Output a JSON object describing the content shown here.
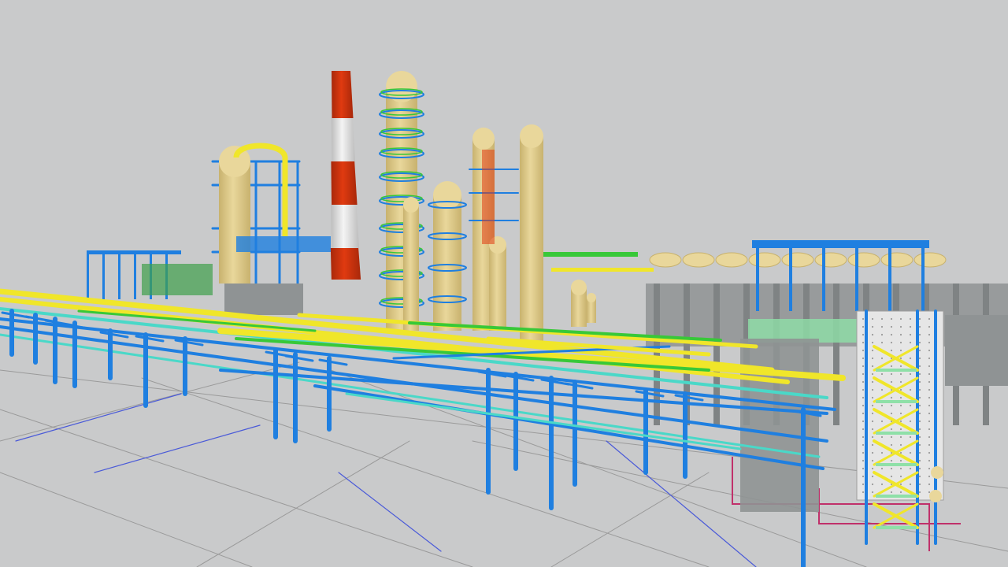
{
  "scene": {
    "subject": "plant-3d-model",
    "colors": {
      "background": "#c9cacb",
      "ground_lines": "#9a9a9a",
      "steel_blue": "#1f7fe0",
      "pipe_yellow": "#f0e62a",
      "pipe_green": "#38c838",
      "pipe_cyan": "#4ad8c8",
      "vessel": "#e9d79b",
      "vessel_shade": "#c8b26e",
      "stack_red": "#e03a10",
      "stack_white": "#f4f4f4",
      "concrete": "#8f9394",
      "platform_green": "#8fe0a8",
      "grating": "#e6e6e6",
      "boundary_magenta": "#c0306a"
    }
  }
}
